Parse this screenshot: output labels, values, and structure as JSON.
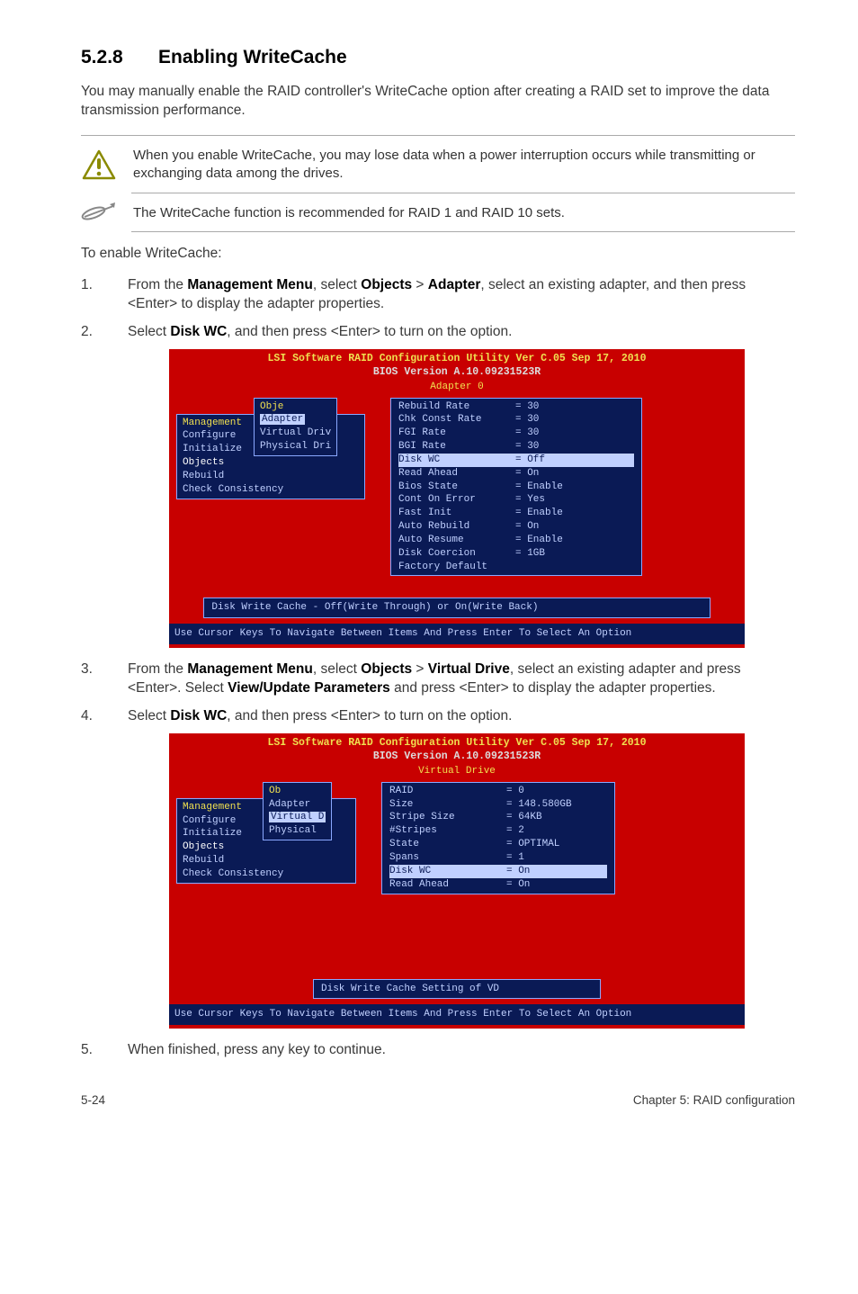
{
  "heading": {
    "number": "5.2.8",
    "title": "Enabling WriteCache"
  },
  "intro": "You may manually enable the RAID controller's WriteCache option after creating a RAID set to improve the data transmission performance.",
  "callout_warn": "When you enable WriteCache, you may lose data when a power interruption occurs while transmitting or exchanging data among the drives.",
  "callout_note": "The WriteCache function is recommended for RAID 1 and RAID 10 sets.",
  "enable_lead": "To enable WriteCache:",
  "steps": {
    "s1_a": "From the ",
    "s1_mgmt": "Management Menu",
    "s1_b": ", select ",
    "s1_obj": "Objects",
    "s1_gt": " > ",
    "s1_adp": "Adapter",
    "s1_c": ", select an existing adapter, and then press <Enter> to display the adapter properties.",
    "s2_a": "Select ",
    "s2_dw": "Disk WC",
    "s2_b": ", and then press <Enter> to turn on the option.",
    "s3_a": "From the ",
    "s3_mgmt": "Management Menu",
    "s3_b": ", select ",
    "s3_obj": "Objects",
    "s3_gt": " > ",
    "s3_vd": "Virtual Drive",
    "s3_c": ", select an existing adapter and press <Enter>. Select ",
    "s3_vup": "View/Update Parameters",
    "s3_d": " and press <Enter> to display the adapter properties.",
    "s4_a": "Select ",
    "s4_dw": "Disk WC",
    "s4_b": ", and then press <Enter> to turn on the option.",
    "s5": "When finished, press any key to continue."
  },
  "term1": {
    "title": "LSI Software RAID Configuration Utility Ver C.05 Sep 17, 2010",
    "bios": "BIOS Version   A.10.09231523R",
    "section": "Adapter 0",
    "mgmt_label": "Management",
    "mgmt_items": [
      "Configure",
      "Initialize",
      "Objects",
      "Rebuild",
      "Check Consistency"
    ],
    "obj_label": "Obje",
    "obj_items": [
      "Adapter",
      "Virtual Driv",
      "Physical Dri"
    ],
    "params": [
      {
        "k": "Rebuild Rate",
        "eq": "= 30"
      },
      {
        "k": "Chk Const Rate",
        "eq": "= 30"
      },
      {
        "k": "FGI Rate",
        "eq": "= 30"
      },
      {
        "k": "BGI Rate",
        "eq": "= 30"
      },
      {
        "k": "Disk WC",
        "eq": "= Off",
        "hl": true
      },
      {
        "k": "Read Ahead",
        "eq": "= On"
      },
      {
        "k": "Bios State",
        "eq": "= Enable"
      },
      {
        "k": "Cont On Error",
        "eq": "= Yes"
      },
      {
        "k": "Fast Init",
        "eq": "= Enable"
      },
      {
        "k": "Auto Rebuild",
        "eq": "= On"
      },
      {
        "k": "Auto Resume",
        "eq": "= Enable"
      },
      {
        "k": "Disk Coercion",
        "eq": "= 1GB"
      },
      {
        "k": "Factory Default",
        "eq": ""
      }
    ],
    "msg": "Disk Write Cache - Off(Write Through) or On(Write Back)",
    "footer": "Use Cursor Keys To Navigate Between Items And Press Enter To Select An Option"
  },
  "term2": {
    "title": "LSI Software RAID Configuration Utility Ver C.05 Sep 17, 2010",
    "bios": "BIOS Version   A.10.09231523R",
    "section": "Virtual Drive",
    "mgmt_label": "Management",
    "mgmt_items": [
      "Configure",
      "Initialize",
      "Objects",
      "Rebuild",
      "Check Consistency"
    ],
    "obj_label": "Ob",
    "obj_items": [
      "Adapter",
      "Virtual D",
      "Physical"
    ],
    "params": [
      {
        "k": "RAID",
        "eq": "= 0"
      },
      {
        "k": "Size",
        "eq": "= 148.580GB"
      },
      {
        "k": "Stripe Size",
        "eq": "= 64KB"
      },
      {
        "k": "#Stripes",
        "eq": "= 2"
      },
      {
        "k": "State",
        "eq": "= OPTIMAL"
      },
      {
        "k": "Spans",
        "eq": "= 1"
      },
      {
        "k": "Disk WC",
        "eq": "= On",
        "hl": true
      },
      {
        "k": "Read Ahead",
        "eq": "= On"
      }
    ],
    "msg": "Disk Write Cache Setting of VD",
    "footer": "Use Cursor Keys To Navigate Between Items And Press Enter To Select An Option"
  },
  "page_footer": {
    "left": "5-24",
    "right": "Chapter 5: RAID configuration"
  }
}
